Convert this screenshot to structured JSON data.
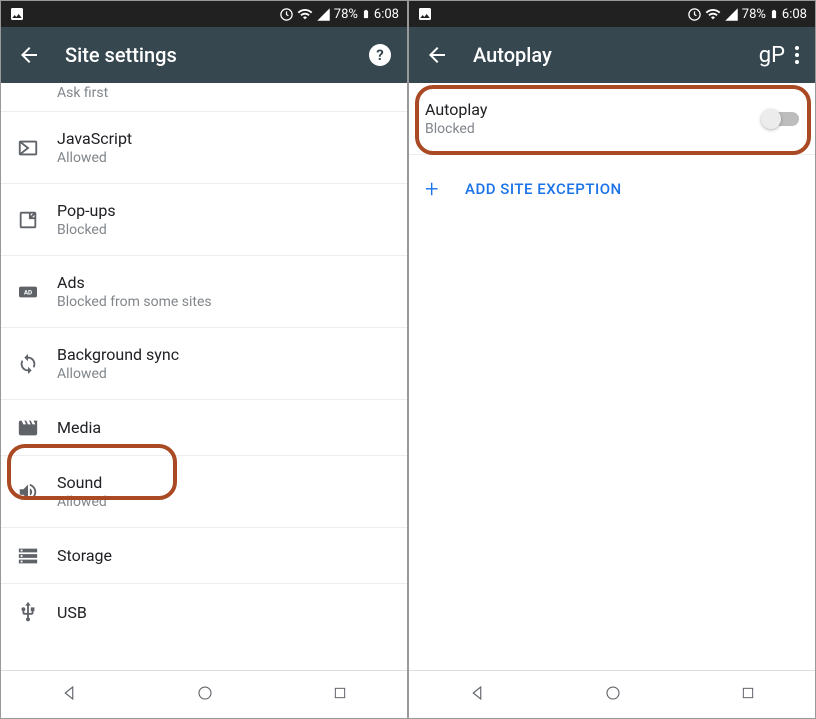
{
  "status": {
    "battery": "78%",
    "time": "6:08"
  },
  "left": {
    "title": "Site settings",
    "askFirst": "Ask first",
    "items": [
      {
        "title": "JavaScript",
        "sub": "Allowed"
      },
      {
        "title": "Pop-ups",
        "sub": "Blocked"
      },
      {
        "title": "Ads",
        "sub": "Blocked from some sites"
      },
      {
        "title": "Background sync",
        "sub": "Allowed"
      },
      {
        "title": "Media",
        "sub": ""
      },
      {
        "title": "Sound",
        "sub": "Allowed"
      },
      {
        "title": "Storage",
        "sub": ""
      },
      {
        "title": "USB",
        "sub": ""
      }
    ]
  },
  "right": {
    "title": "Autoplay",
    "autoplay": {
      "title": "Autoplay",
      "sub": "Blocked"
    },
    "addException": "ADD SITE EXCEPTION",
    "gp": "gP"
  }
}
